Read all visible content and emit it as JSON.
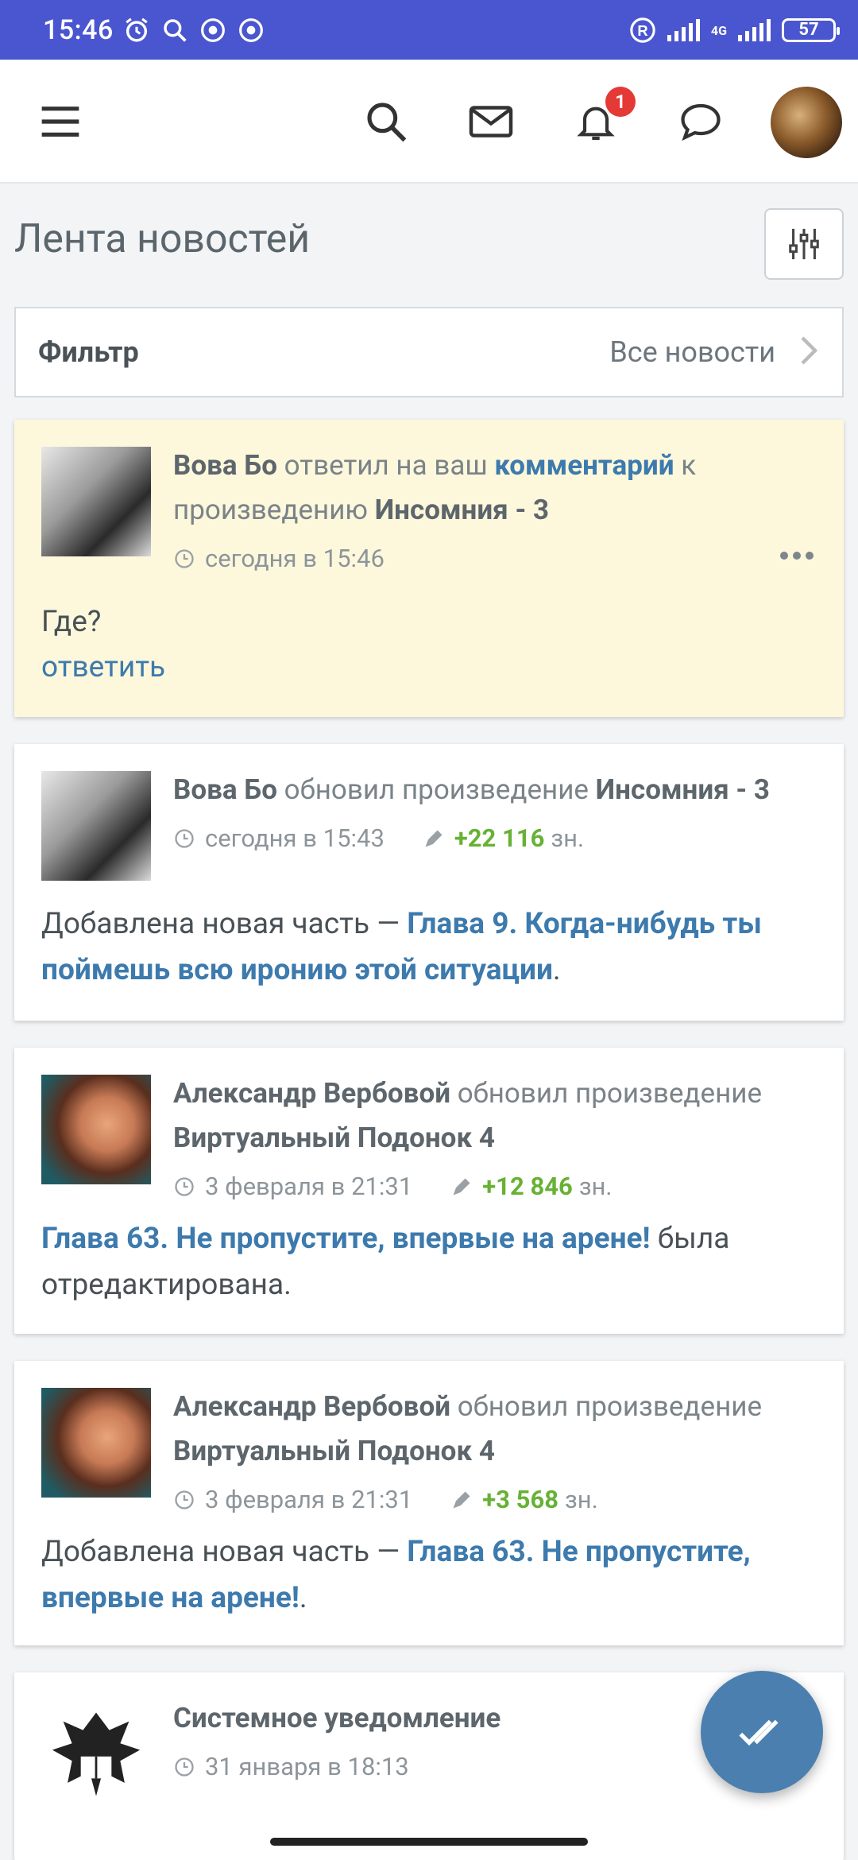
{
  "status_bar": {
    "time": "15:46",
    "battery": "57",
    "network": "4G"
  },
  "appbar": {
    "notification_count": "1"
  },
  "page_title": "Лента новостей",
  "filter": {
    "label": "Фильтр",
    "value": "Все новости"
  },
  "feed": [
    {
      "author": "Вова Бо",
      "action_1": "ответил на ваш",
      "link_1": "комментарий",
      "action_2": "к произведению",
      "work": "Инсомния - 3",
      "time": "сегодня в 15:46",
      "text": "Где?",
      "reply": "ответить"
    },
    {
      "author": "Вова Бо",
      "action": "обновил произведение",
      "work": "Инсомния - 3",
      "time": "сегодня в 15:43",
      "chars": "+22 116",
      "chars_unit": "зн.",
      "text_prefix": "Добавлена новая часть —",
      "chapter": "Глава 9. Когда-нибудь ты поймешь всю иронию этой ситуации",
      "text_suffix": "."
    },
    {
      "author": "Александр Вербовой",
      "action": "обновил произведение",
      "work": "Виртуальный Подонок 4",
      "time": "3 февраля в 21:31",
      "chars": "+12 846",
      "chars_unit": "зн.",
      "chapter": "Глава 63. Не пропустите, впервые на арене!",
      "text_suffix": "была отредактирована."
    },
    {
      "author": "Александр Вербовой",
      "action": "обновил произведение",
      "work": "Виртуальный Подонок 4",
      "time": "3 февраля в 21:31",
      "chars": "+3 568",
      "chars_unit": "зн.",
      "text_prefix": "Добавлена новая часть —",
      "chapter": "Глава 63. Не пропустите, впервые на арене!",
      "text_suffix": "."
    },
    {
      "author": "Системное уведомление",
      "time": "31 января в 18:13"
    }
  ]
}
